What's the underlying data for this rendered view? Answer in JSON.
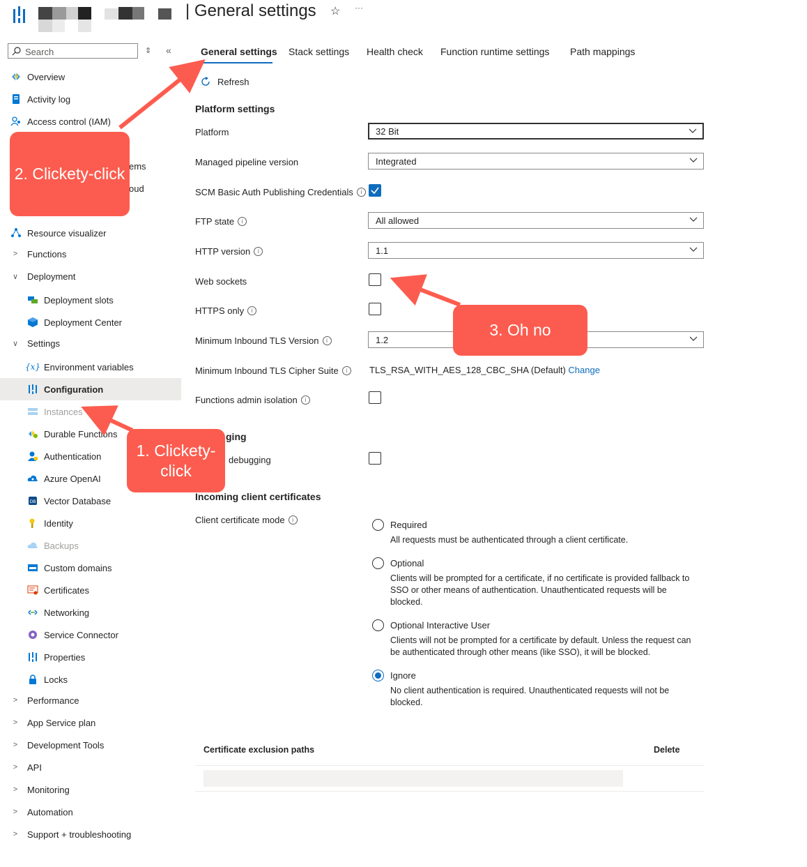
{
  "header": {
    "title": "| General settings",
    "favorite_icon": "star-icon",
    "more_icon": "ellipsis-icon"
  },
  "sidebar": {
    "search_placeholder": "Search",
    "items": [
      {
        "label": "Overview",
        "icon": "function-app-icon"
      },
      {
        "label": "Activity log",
        "icon": "log-icon"
      },
      {
        "label": "Access control (IAM)",
        "icon": "people-icon"
      },
      {
        "label": "ems"
      },
      {
        "label": "oud"
      },
      {
        "label": "Resource visualizer",
        "icon": "visualizer-icon"
      }
    ],
    "groups": {
      "functions": "Functions",
      "deployment": "Deployment",
      "settings": "Settings",
      "performance": "Performance",
      "app_service_plan": "App Service plan",
      "development_tools": "Development Tools",
      "api": "API",
      "monitoring": "Monitoring",
      "automation": "Automation",
      "support": "Support + troubleshooting"
    },
    "deployment_items": [
      "Deployment slots",
      "Deployment Center"
    ],
    "settings_items": [
      "Environment variables",
      "Configuration",
      "Instances",
      "Durable Functions",
      "Authentication",
      "Azure OpenAI",
      "Vector Database",
      "Identity",
      "Backups",
      "Custom domains",
      "Certificates",
      "Networking",
      "Service Connector",
      "Properties",
      "Locks"
    ]
  },
  "tabs": [
    "General settings",
    "Stack settings",
    "Health check",
    "Function runtime settings",
    "Path mappings"
  ],
  "toolbar": {
    "refresh": "Refresh"
  },
  "platform": {
    "section_title": "Platform settings",
    "platform_label": "Platform",
    "platform_value": "32 Bit",
    "pipeline_label": "Managed pipeline version",
    "pipeline_value": "Integrated",
    "scm_label": "SCM Basic Auth Publishing Credentials",
    "ftp_label": "FTP state",
    "ftp_value": "All allowed",
    "http_label": "HTTP version",
    "http_value": "1.1",
    "websockets_label": "Web sockets",
    "https_label": "HTTPS only",
    "tls_label": "Minimum Inbound TLS Version",
    "tls_value": "1.2",
    "cipher_label": "Minimum Inbound TLS Cipher Suite",
    "cipher_value": "TLS_RSA_WITH_AES_128_CBC_SHA (Default)",
    "cipher_change": "Change",
    "admin_isolation_label": "Functions admin isolation"
  },
  "debugging": {
    "section_fragment": "ging",
    "label_fragment": "debugging"
  },
  "certs": {
    "section_title": "Incoming client certificates",
    "mode_label": "Client certificate mode",
    "options": [
      {
        "title": "Required",
        "desc": "All requests must be authenticated through a client certificate."
      },
      {
        "title": "Optional",
        "desc": "Clients will be prompted for a certificate, if no certificate is provided fallback to SSO or other means of authentication. Unauthenticated requests will be blocked."
      },
      {
        "title": "Optional Interactive User",
        "desc": "Clients will not be prompted for a certificate by default. Unless the request can be authenticated through other means (like SSO), it will be blocked."
      },
      {
        "title": "Ignore",
        "desc": "No client authentication is required. Unauthenticated requests will not be blocked."
      }
    ],
    "selected": "Ignore",
    "exclusion_header": "Certificate exclusion paths",
    "delete_header": "Delete"
  },
  "callouts": {
    "one": "1. Clickety-click",
    "two": "2. Clickety-click",
    "three": "3. Oh no",
    "color": "#fc5c4f"
  }
}
